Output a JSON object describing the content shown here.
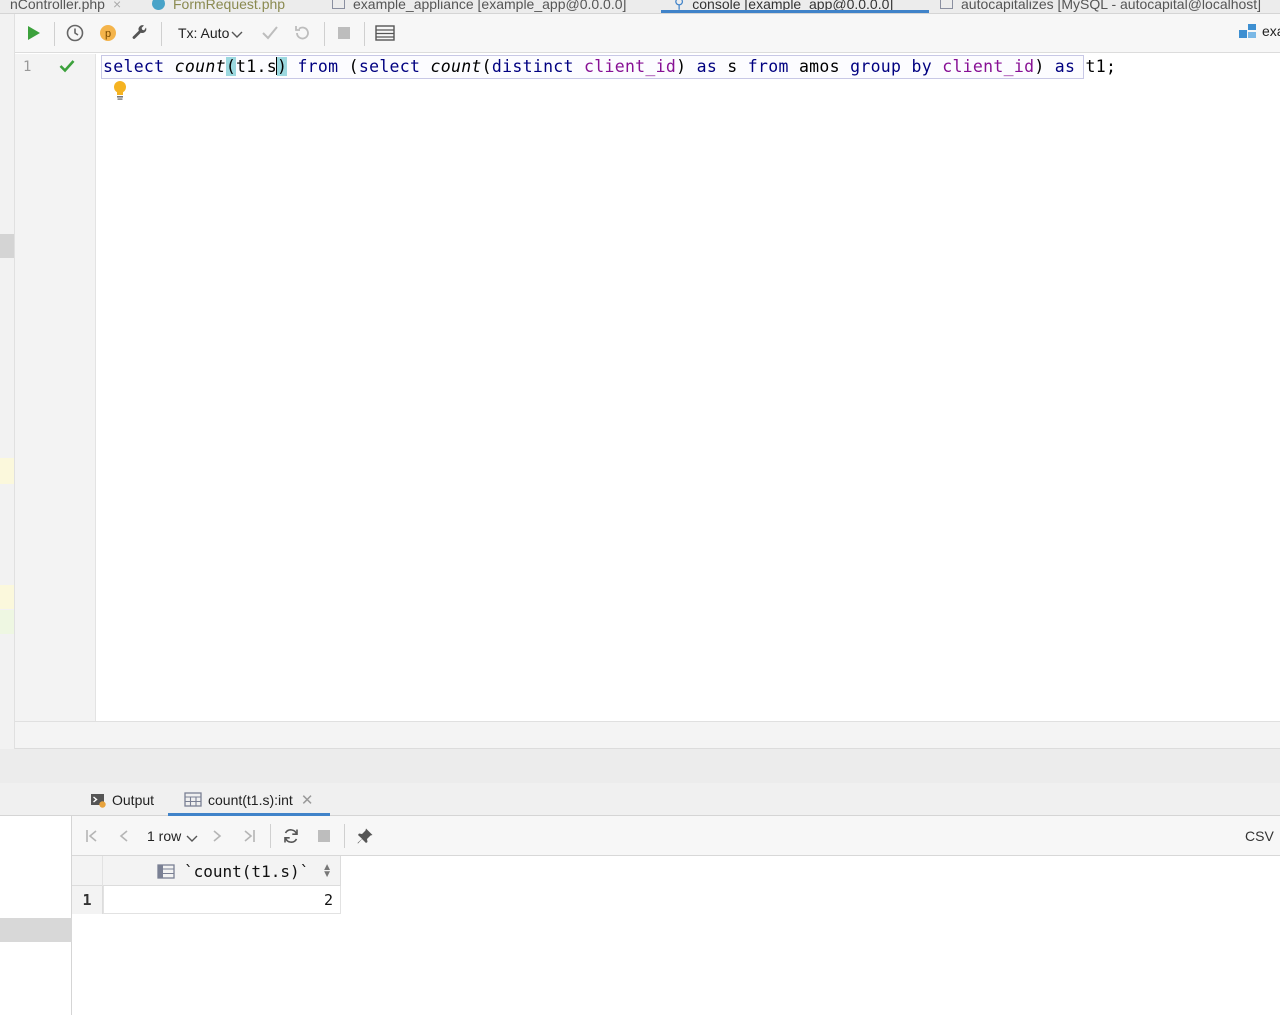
{
  "tabs": [
    {
      "label": "nController.php",
      "icon": "php-file-icon"
    },
    {
      "label": "FormRequest.php",
      "icon": "php-class-icon"
    },
    {
      "label": "example_appliance [example_app@0.0.0.0]",
      "icon": "table-icon"
    },
    {
      "label": "console [example_app@0.0.0.0]",
      "icon": "console-icon",
      "active": true
    },
    {
      "label": "autocapitalizes [MySQL - autocapital@localhost]",
      "icon": "table-icon"
    }
  ],
  "toolbar": {
    "tx_mode": "Tx: Auto",
    "right_label": "exa",
    "icons": [
      "run-icon",
      "history-icon",
      "parameters-icon",
      "settings-wrench-icon",
      "commit-icon",
      "rollback-icon",
      "stop-icon",
      "table-layout-icon"
    ]
  },
  "editor": {
    "line_number": "1",
    "query_tokens": {
      "t1": "select",
      "t2": "count",
      "t3": "(",
      "t4": "t1.s",
      "t5": ")",
      "t6": "from",
      "t7": "(",
      "t8": "select",
      "t9": "count",
      "t10": "(",
      "t11": "distinct",
      "t12": "client_id",
      "t13": ")",
      "t14": "as",
      "t15": "s",
      "t16": "from",
      "t17": "amos",
      "t18": "group",
      "t19": "by",
      "t20": "client_id",
      "t21": ")",
      "t22": "as",
      "t23": "t1;"
    },
    "status": "ok",
    "colors": {
      "keyword": "#000080",
      "column": "#871094",
      "paren_highlight": "#9bd8df"
    }
  },
  "results": {
    "tabs": [
      {
        "label": "Output",
        "icon": "output-icon"
      },
      {
        "label": "count(t1.s):int",
        "icon": "table-icon",
        "active": true
      }
    ],
    "toolbar": {
      "rows_label": "1 row",
      "export_format": "CSV"
    },
    "columns": [
      "`count(t1.s)`"
    ],
    "rows": [
      {
        "row_number": "1",
        "values": [
          "2"
        ]
      }
    ]
  },
  "accent_color": "#4083c9"
}
